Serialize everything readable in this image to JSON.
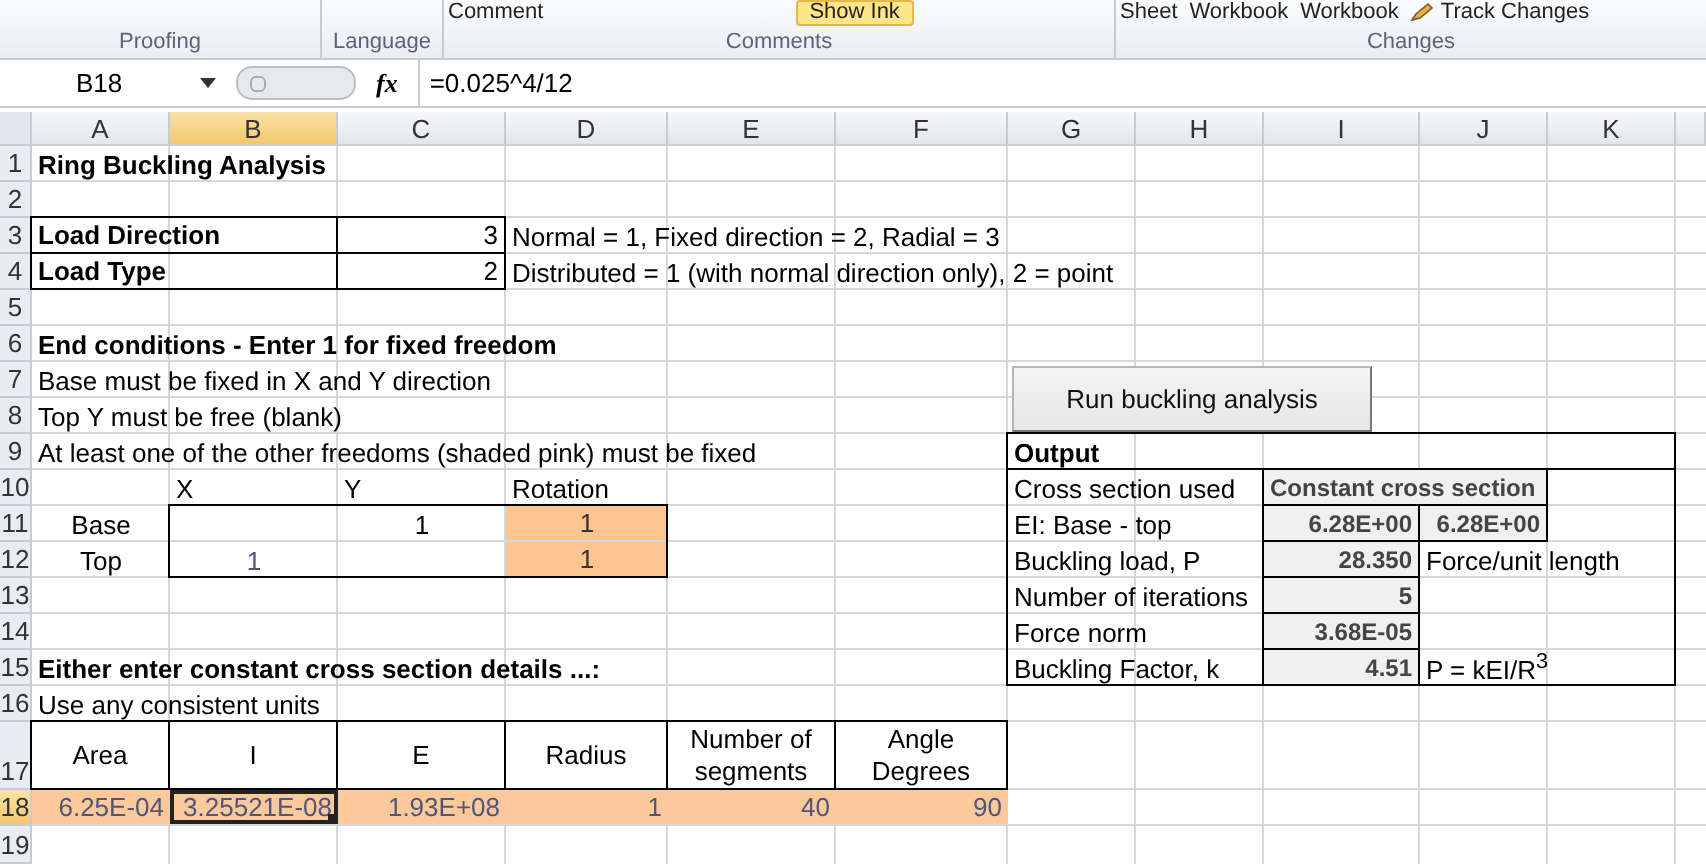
{
  "ribbon": {
    "groups": [
      {
        "label": "Proofing"
      },
      {
        "label": "Language"
      },
      {
        "label": "Comments",
        "items": [
          {
            "kind": "text",
            "label": "Comment"
          },
          {
            "kind": "toggle",
            "label": "Show Ink",
            "on": true
          }
        ]
      },
      {
        "label": "Changes",
        "items": [
          {
            "kind": "text",
            "label": "Sheet"
          },
          {
            "kind": "text",
            "label": "Workbook"
          },
          {
            "kind": "text",
            "label": "Workbook"
          },
          {
            "kind": "tool",
            "label": "Track Changes"
          }
        ]
      }
    ]
  },
  "formula_bar": {
    "name_box": "B18",
    "function_label": "fx",
    "formula": "=0.025^4/12"
  },
  "column_headers": [
    {
      "label": "A",
      "selected": false
    },
    {
      "label": "B",
      "selected": true
    },
    {
      "label": "C",
      "selected": false
    },
    {
      "label": "D",
      "selected": false
    },
    {
      "label": "E",
      "selected": false
    },
    {
      "label": "F",
      "selected": false
    },
    {
      "label": "G",
      "selected": false
    },
    {
      "label": "H",
      "selected": false
    },
    {
      "label": "I",
      "selected": false
    },
    {
      "label": "J",
      "selected": false
    },
    {
      "label": "K",
      "selected": false
    }
  ],
  "row_headers": [
    {
      "label": "1",
      "selected": false
    },
    {
      "label": "2",
      "selected": false
    },
    {
      "label": "3",
      "selected": false
    },
    {
      "label": "4",
      "selected": false
    },
    {
      "label": "5",
      "selected": false
    },
    {
      "label": "6",
      "selected": false
    },
    {
      "label": "7",
      "selected": false
    },
    {
      "label": "8",
      "selected": false
    },
    {
      "label": "9",
      "selected": false
    },
    {
      "label": "10",
      "selected": false
    },
    {
      "label": "11",
      "selected": false
    },
    {
      "label": "12",
      "selected": false
    },
    {
      "label": "13",
      "selected": false
    },
    {
      "label": "14",
      "selected": false
    },
    {
      "label": "15",
      "selected": false
    },
    {
      "label": "16",
      "selected": false
    },
    {
      "label": "17",
      "selected": false
    },
    {
      "label": "18",
      "selected": true
    },
    {
      "label": "19",
      "selected": false
    }
  ],
  "cells": [
    {
      "text": "Ring Buckling Analysis",
      "kind": "heading",
      "selected": false
    },
    {
      "text": "Load Direction",
      "kind": "label",
      "selected": false
    },
    {
      "text": "3",
      "kind": "value",
      "selected": false
    },
    {
      "text": "Normal = 1, Fixed direction = 2, Radial = 3",
      "kind": "text",
      "selected": false
    },
    {
      "text": "Load Type",
      "kind": "label",
      "selected": false
    },
    {
      "text": "2",
      "kind": "value",
      "selected": false
    },
    {
      "text": "Distributed = 1 (with normal direction only), 2 = point",
      "kind": "text",
      "selected": false
    },
    {
      "text": "End conditions - Enter 1 for fixed freedom",
      "kind": "heading",
      "selected": false
    },
    {
      "text": "Base must be fixed in X and Y direction",
      "kind": "text",
      "selected": false
    },
    {
      "text": "Top Y must be free (blank)",
      "kind": "text",
      "selected": false
    },
    {
      "text": "At least one of the other freedoms (shaded pink) must be fixed",
      "kind": "text",
      "selected": false
    },
    {
      "text": "X",
      "kind": "text",
      "selected": false
    },
    {
      "text": "Y",
      "kind": "text",
      "selected": false
    },
    {
      "text": "Rotation",
      "kind": "text",
      "selected": false
    },
    {
      "text": "Base",
      "kind": "centered",
      "selected": false
    },
    {
      "text": "1",
      "kind": "centered",
      "selected": false
    },
    {
      "text": "1",
      "kind": "shaded",
      "selected": false
    },
    {
      "text": "Top",
      "kind": "centered",
      "selected": false
    },
    {
      "text": "1",
      "kind": "entry",
      "selected": false
    },
    {
      "text": "1",
      "kind": "shaded",
      "selected": false
    },
    {
      "text": "Either enter constant cross section details ...:",
      "kind": "heading",
      "selected": false
    },
    {
      "text": "Use any consistent units",
      "kind": "text",
      "selected": false
    },
    {
      "text": "Area",
      "kind": "header",
      "selected": false
    },
    {
      "text": "I",
      "kind": "header",
      "selected": false
    },
    {
      "text": "E",
      "kind": "header",
      "selected": false
    },
    {
      "text": "Radius",
      "kind": "header",
      "selected": false
    },
    {
      "text": "Number of segments",
      "kind": "header",
      "selected": false
    },
    {
      "text": "Angle Degrees",
      "kind": "header",
      "selected": false
    },
    {
      "text": "6.25E-04",
      "kind": "data",
      "selected": false
    },
    {
      "text": "3.25521E-08",
      "kind": "data",
      "selected": true
    },
    {
      "text": "1.93E+08",
      "kind": "data",
      "selected": false
    },
    {
      "text": "1",
      "kind": "data",
      "selected": false
    },
    {
      "text": "40",
      "kind": "data",
      "selected": false
    },
    {
      "text": "90",
      "kind": "data",
      "selected": false
    },
    {
      "text": "Output",
      "kind": "heading",
      "selected": false
    },
    {
      "text": "Cross section used",
      "kind": "text",
      "selected": false
    },
    {
      "text": "Constant cross section",
      "kind": "banner",
      "selected": false
    },
    {
      "text": "EI:  Base - top",
      "kind": "text",
      "selected": false
    },
    {
      "text": "6.28E+00",
      "kind": "result",
      "selected": false
    },
    {
      "text": "6.28E+00",
      "kind": "result",
      "selected": false
    },
    {
      "text": "Buckling load, P",
      "kind": "text",
      "selected": false
    },
    {
      "text": "28.350",
      "kind": "result",
      "selected": false
    },
    {
      "text": "Force/unit length",
      "kind": "text",
      "selected": false
    },
    {
      "text": "Number of iterations",
      "kind": "text",
      "selected": false
    },
    {
      "text": "5",
      "kind": "result",
      "selected": false
    },
    {
      "text": "Force norm",
      "kind": "text",
      "selected": false
    },
    {
      "text": "3.68E-05",
      "kind": "result",
      "selected": false
    },
    {
      "text": "Buckling Factor, k",
      "kind": "text",
      "selected": false
    },
    {
      "text": "4.51",
      "kind": "result",
      "selected": false
    },
    {
      "text": "P = kEI/R$^{3}$",
      "kind": "text",
      "selected": false
    }
  ],
  "button": {
    "label": "Run buckling analysis"
  }
}
